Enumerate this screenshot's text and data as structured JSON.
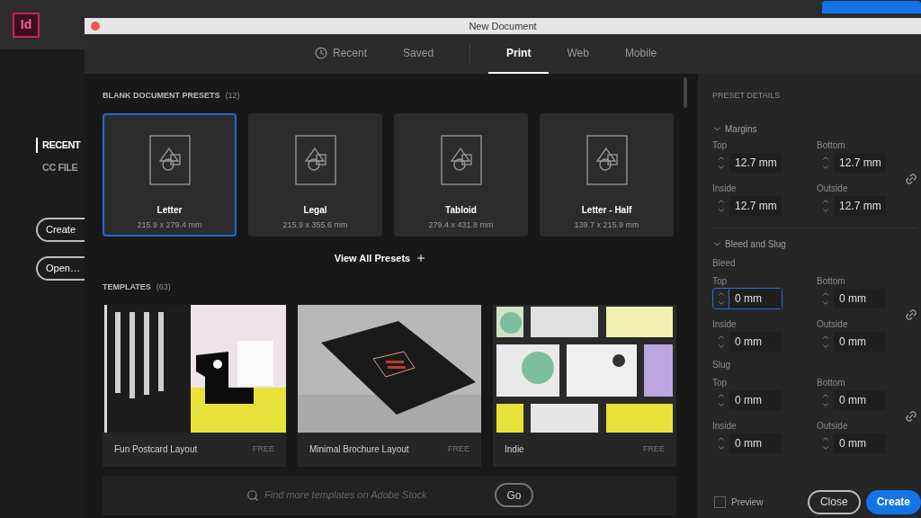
{
  "app": {
    "logo": "Id",
    "sidebar": [
      {
        "label": "RECENT",
        "selected": true
      },
      {
        "label": "CC FILE",
        "selected": false
      }
    ],
    "buttons": [
      "Create",
      "Open…"
    ]
  },
  "dialog": {
    "title": "New Document",
    "tabs": [
      {
        "label": "Recent",
        "kind": "history",
        "divider_before": false,
        "selected": false
      },
      {
        "label": "Saved",
        "kind": "plain",
        "divider_before": false,
        "selected": false
      },
      {
        "label": "Print",
        "kind": "plain",
        "divider_before": true,
        "selected": true
      },
      {
        "label": "Web",
        "kind": "plain",
        "divider_before": false,
        "selected": false
      },
      {
        "label": "Mobile",
        "kind": "plain",
        "divider_before": false,
        "selected": false
      }
    ],
    "presets": {
      "heading": "BLANK DOCUMENT PRESETS",
      "count": "(12)",
      "view_all": "View All Presets",
      "items": [
        {
          "name": "Letter",
          "size": "215.9 x 279.4 mm",
          "selected": true
        },
        {
          "name": "Legal",
          "size": "215.9 x 355.6 mm",
          "selected": false
        },
        {
          "name": "Tabloid",
          "size": "279.4 x 431.8 mm",
          "selected": false
        },
        {
          "name": "Letter - Half",
          "size": "139.7 x 215.9 mm",
          "selected": false
        }
      ]
    },
    "templates": {
      "heading": "TEMPLATES",
      "count": "(63)",
      "items": [
        {
          "title": "Fun Postcard Layout",
          "price": "FREE",
          "kind": "postcard"
        },
        {
          "title": "Minimal Brochure Layout",
          "price": "FREE",
          "kind": "brochure"
        },
        {
          "title": "Indie",
          "price": "FREE",
          "kind": "magazine"
        }
      ]
    },
    "search": {
      "placeholder": "Find more templates on Adobe Stock",
      "button": "Go"
    },
    "details": {
      "heading": "PRESET DETAILS",
      "sections": [
        {
          "title": "Margins",
          "expanded": true,
          "groups": [
            {
              "fields": [
                {
                  "label": "Top",
                  "value": "12.7 mm",
                  "focused": false
                },
                {
                  "label": "Bottom",
                  "value": "12.7 mm",
                  "focused": false
                },
                {
                  "label": "Inside",
                  "value": "12.7 mm",
                  "focused": false
                },
                {
                  "label": "Outside",
                  "value": "12.7 mm",
                  "focused": false
                }
              ]
            }
          ]
        },
        {
          "title": "Bleed and Slug",
          "expanded": true,
          "groups": [
            {
              "label": "Bleed",
              "fields": [
                {
                  "label": "Top",
                  "value": "0 mm",
                  "focused": true
                },
                {
                  "label": "Bottom",
                  "value": "0 mm",
                  "focused": false
                },
                {
                  "label": "Inside",
                  "value": "0 mm",
                  "focused": false
                },
                {
                  "label": "Outside",
                  "value": "0 mm",
                  "focused": false
                }
              ]
            },
            {
              "label": "Slug",
              "fields": [
                {
                  "label": "Top",
                  "value": "0 mm",
                  "focused": false
                },
                {
                  "label": "Bottom",
                  "value": "0 mm",
                  "focused": false
                },
                {
                  "label": "Inside",
                  "value": "0 mm",
                  "focused": false
                },
                {
                  "label": "Outside",
                  "value": "0 mm",
                  "focused": false
                }
              ]
            }
          ]
        }
      ],
      "preview": {
        "label": "Preview",
        "checked": false
      },
      "buttons": [
        {
          "label": "Close",
          "kind": "secondary"
        },
        {
          "label": "Create",
          "kind": "primary"
        }
      ]
    }
  }
}
